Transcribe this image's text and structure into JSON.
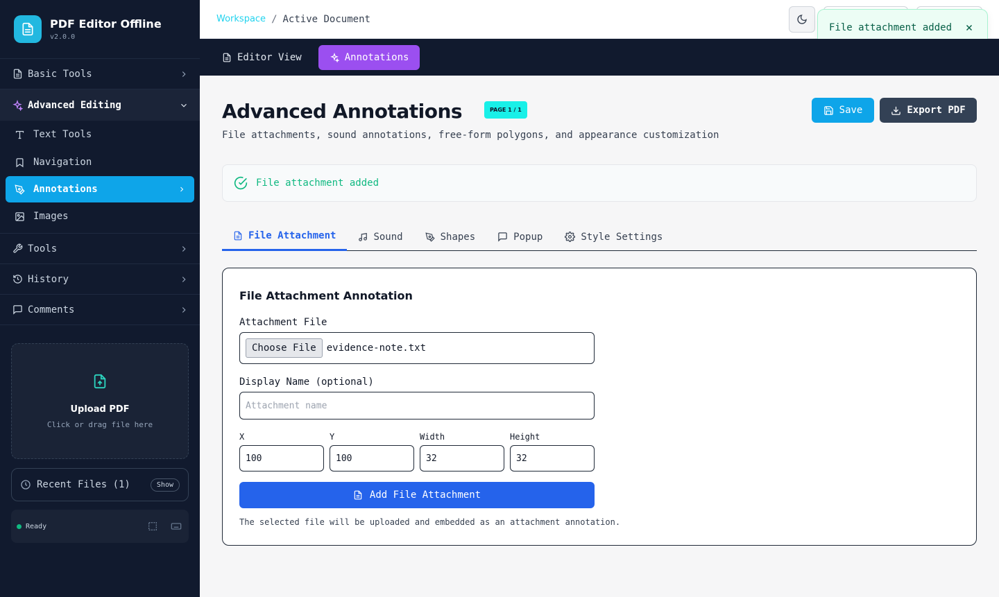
{
  "brand": {
    "title": "PDF Editor Offline",
    "version": "v2.0.0"
  },
  "sidebar": {
    "basic_tools": "Basic Tools",
    "advanced_editing": "Advanced Editing",
    "sub_items": [
      "Text Tools",
      "Navigation",
      "Annotations",
      "Images"
    ],
    "tools": "Tools",
    "history": "History",
    "comments": "Comments",
    "upload_title": "Upload PDF",
    "upload_sub": "Click or drag file here",
    "recent_label": "Recent Files (1)",
    "recent_show": "Show",
    "status": "Ready"
  },
  "topbar": {
    "crumb_root": "Workspace",
    "crumb_sep": "/",
    "crumb_current": "Active Document"
  },
  "toast": {
    "message": "File attachment added"
  },
  "viewbar": {
    "editor": "Editor View",
    "annotations": "Annotations"
  },
  "main": {
    "title": "Advanced Annotations",
    "badge": "PAGE 1 / 1",
    "description": "File attachments, sound annotations, free-form polygons, and appearance customization",
    "save": "Save",
    "export": "Export PDF",
    "alert": "File attachment added"
  },
  "tabs": [
    "File Attachment",
    "Sound",
    "Shapes",
    "Popup",
    "Style Settings"
  ],
  "form": {
    "title": "File Attachment Annotation",
    "file_label": "Attachment File",
    "choose_btn": "Choose File",
    "file_name": "evidence-note.txt",
    "display_label": "Display Name (optional)",
    "display_placeholder": "Attachment name",
    "x_label": "X",
    "x_value": "100",
    "y_label": "Y",
    "y_value": "100",
    "w_label": "Width",
    "w_value": "32",
    "h_label": "Height",
    "h_value": "32",
    "add_btn": "Add File Attachment",
    "helper": "The selected file will be uploaded and embedded as an attachment annotation."
  },
  "colors": {
    "accent": "#0ea5e9",
    "purple": "#9b4ff0",
    "blue": "#2563eb",
    "success": "#10b981",
    "sidebar": "#111a2e"
  }
}
